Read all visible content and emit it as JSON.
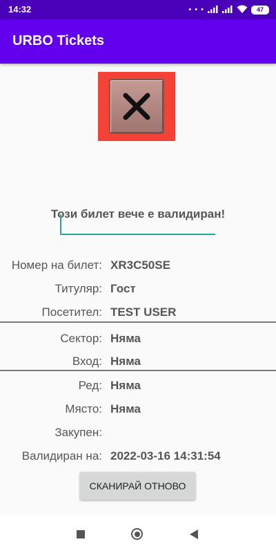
{
  "status_bar": {
    "time": "14:32",
    "dots": "• • •",
    "battery": "47",
    "icons": [
      "signal-icon",
      "wifi-icon",
      "battery-icon"
    ]
  },
  "app_bar": {
    "title": "URBO Tickets"
  },
  "status_image": {
    "icon": "close-icon",
    "background_color": "#f44336"
  },
  "message": "Този билет вече е валидиран!",
  "details": {
    "ticket_number_label": "Номер на билет:",
    "ticket_number_value": "XR3C50SE",
    "holder_label": "Титуляр:",
    "holder_value": "Гост",
    "visitor_label": "Посетител:",
    "visitor_value": "TEST USER",
    "sector_label": "Сектор:",
    "sector_value": "Няма",
    "entrance_label": "Вход:",
    "entrance_value": "Няма",
    "row_label": "Ред:",
    "row_value": "Няма",
    "seat_label": "Място:",
    "seat_value": "Няма",
    "purchased_label": "Закупен:",
    "purchased_value": "",
    "validated_label": "Валидиран на:",
    "validated_value": "2022-03-16 14:31:54"
  },
  "rescan_button_label": "СКАНИРАЙ ОТНОВО",
  "nav_bar": {
    "icons": [
      "recents-icon",
      "home-icon",
      "back-icon"
    ]
  },
  "colors": {
    "app_bar": "#6200ee",
    "status_bar": "#4a00b8",
    "accent": "#26a69a",
    "error": "#f44336"
  }
}
